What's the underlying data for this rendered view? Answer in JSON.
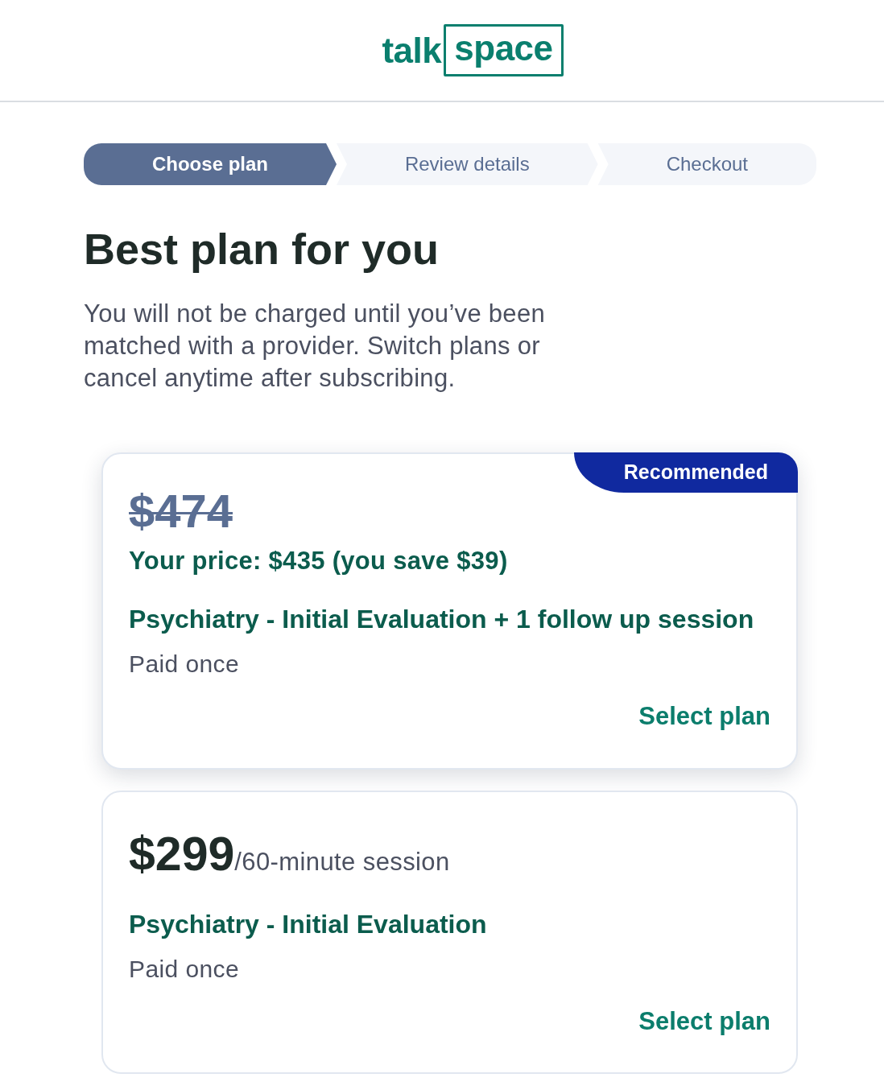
{
  "logo": {
    "words": [
      "talk",
      "space"
    ]
  },
  "steps": [
    {
      "label": "Choose plan",
      "active": true
    },
    {
      "label": "Review details",
      "active": false
    },
    {
      "label": "Checkout",
      "active": false
    }
  ],
  "heading": "Best plan for you",
  "intro": "You will not be charged until you’ve been matched with a provider. Switch plans or cancel anytime after subscribing.",
  "plans": [
    {
      "kind": "discounted",
      "recommended": true,
      "badge": "Recommended",
      "original_price": "$474",
      "your_price": "Your price: $435 (you save $39)",
      "title": "Psychiatry - Initial Evaluation + 1 follow up session",
      "billing": "Paid once",
      "action": "Select plan"
    },
    {
      "kind": "standard",
      "recommended": false,
      "price": "$299",
      "price_unit": "/60-minute session",
      "title": "Psychiatry - Initial Evaluation",
      "billing": "Paid once",
      "action": "Select plan"
    }
  ]
}
